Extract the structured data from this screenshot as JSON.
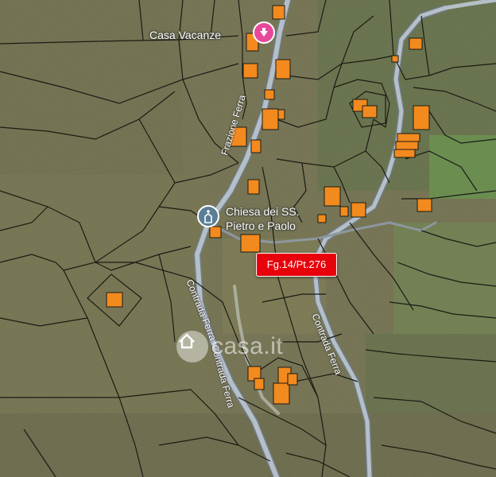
{
  "map": {
    "base": "satellite-with-cadastral-overlay",
    "colors": {
      "parcel_line": "#1b1b14",
      "building_fill": "#f28a1e",
      "road": "#a9b4bf",
      "highlight_tag": "#e8000b",
      "field_green": "#5f8a45"
    }
  },
  "pois": [
    {
      "name": "Casa Vacanze",
      "icon": "marker-pink-icon"
    },
    {
      "name_line1": "Chiesa dei SS.",
      "name_line2": "Pietro e Paolo",
      "icon": "church-icon"
    }
  ],
  "roads": [
    {
      "label": "Frazione Ferra"
    },
    {
      "label": "Contrada Ferra"
    },
    {
      "label": "Contrada Ferra"
    },
    {
      "label": "Contrada Ferra"
    }
  ],
  "parcel_tag": {
    "label": "Fg.14/Pt.276"
  },
  "watermark": {
    "label": "casa.it",
    "icon": "casa-logo-icon"
  }
}
